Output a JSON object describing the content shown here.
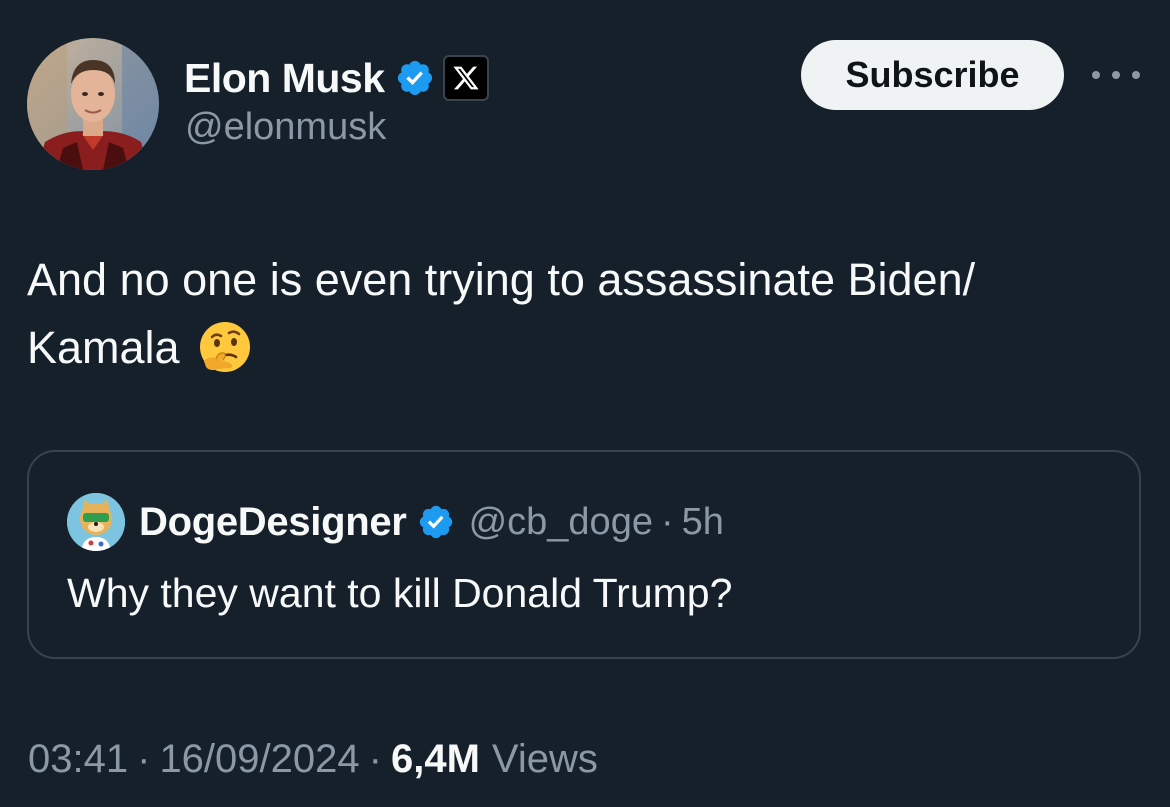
{
  "author": {
    "display_name": "Elon Musk",
    "handle": "@elonmusk",
    "verified_icon": "verified-badge-icon",
    "affiliation_icon": "x-logo-icon"
  },
  "actions": {
    "subscribe_label": "Subscribe",
    "more_icon": "more-horizontal-icon"
  },
  "tweet": {
    "line1": "And no one is even trying to assassinate Biden/",
    "line2": "Kamala",
    "emoji": "thinking-face-emoji"
  },
  "quoted": {
    "display_name": "DogeDesigner",
    "handle": "@cb_doge",
    "separator": "·",
    "time": "5h",
    "text": "Why they want to kill Donald Trump?"
  },
  "footer": {
    "time": "03:41",
    "separator": "·",
    "date": "16/09/2024",
    "views_count": "6,4M",
    "views_label": "Views"
  },
  "colors": {
    "background": "#15202b",
    "verified_blue": "#1d9bf0",
    "secondary_text": "#8b98a5",
    "primary_text": "#f7f9f9",
    "border": "#38444d"
  }
}
